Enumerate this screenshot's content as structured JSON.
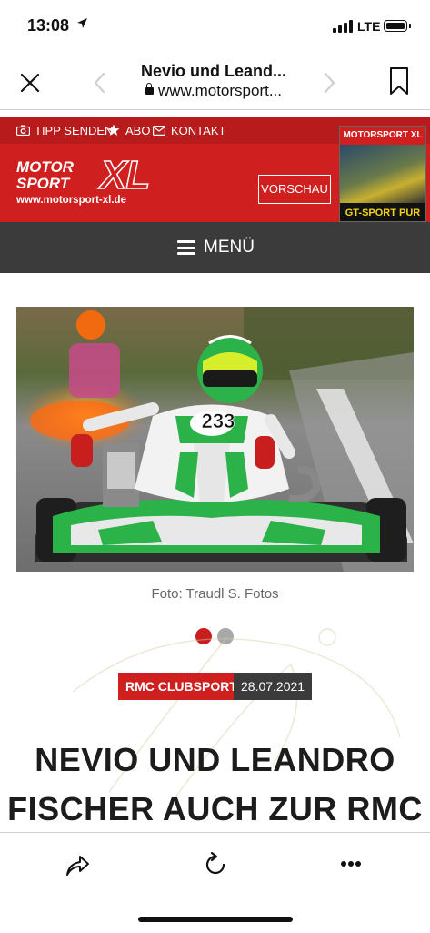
{
  "status": {
    "time": "13:08",
    "network": "LTE"
  },
  "browser": {
    "title": "Nevio und Leand...",
    "url": "www.motorsport..."
  },
  "site": {
    "topnav": {
      "tip": "TIPP SENDEN",
      "abo": "ABO",
      "contact": "KONTAKT"
    },
    "logo": {
      "line1": "MOTOR",
      "line2": "SPORT",
      "xl": "XL",
      "url": "www.motorsport-xl.de"
    },
    "preview_button": "VORSCHAU",
    "magazine": {
      "title": "MOTORSPORT XL",
      "subtitle": "GT-SPORT PUR"
    },
    "menu_label": "MENÜ"
  },
  "article": {
    "photo": {
      "kart_number": "233"
    },
    "caption": "Foto: Traudl S. Fotos",
    "carousel": {
      "active_index": 0,
      "count": 2
    },
    "category": "RMC CLUBSPORT",
    "date": "28.07.2021",
    "headline_line1": "NEVIO UND LEANDRO",
    "headline_line2": "FISCHER AUCH ZUR RMC"
  },
  "colors": {
    "brand_red": "#cf1f1f",
    "dark_gray": "#3b3b3b",
    "inactive_dot": "#a8a8a8"
  },
  "icons": [
    "location-arrow-icon",
    "signal-icon",
    "battery-icon",
    "close-icon",
    "back-icon",
    "forward-icon",
    "lock-icon",
    "bookmark-icon",
    "camera-icon",
    "star-icon",
    "mail-icon",
    "menu-icon",
    "share-icon",
    "reload-icon",
    "more-icon"
  ]
}
